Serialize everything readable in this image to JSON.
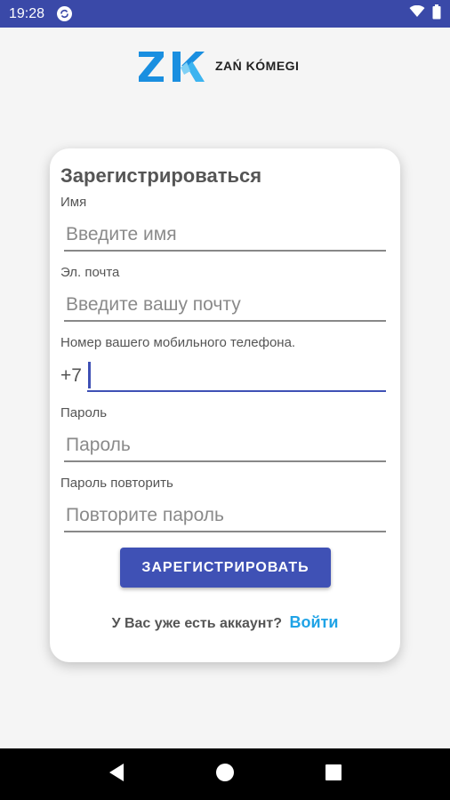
{
  "status_bar": {
    "time": "19:28",
    "icons": [
      "sync-icon",
      "wifi-icon",
      "battery-icon"
    ]
  },
  "logo": {
    "mark": "ZK",
    "text": "ZAŃ KÓMEGI",
    "colors": {
      "primary": "#1a8fe0",
      "secondary": "#3cb4f0"
    }
  },
  "form": {
    "title": "Зарегистрироваться",
    "name": {
      "label": "Имя",
      "placeholder": "Введите имя",
      "value": ""
    },
    "email": {
      "label": "Эл. почта",
      "placeholder": "Введите вашу почту",
      "value": ""
    },
    "phone": {
      "label": "Номер вашего мобильного телефона.",
      "prefix": "+7",
      "value": ""
    },
    "password": {
      "label": "Пароль",
      "placeholder": "Пароль",
      "value": ""
    },
    "password_repeat": {
      "label": "Пароль повторить",
      "placeholder": "Повторите пароль",
      "value": ""
    },
    "submit_label": "ЗАРЕГИСТРИРОВАТЬ",
    "login_prompt": "У Вас уже есть аккаунт?",
    "login_link": "Войти"
  },
  "nav_bar": {
    "buttons": [
      "back-icon",
      "home-icon",
      "recents-icon"
    ]
  },
  "colors": {
    "status_bar": "#3a49a8",
    "accent": "#3f51b5",
    "link": "#1fa3e6",
    "background": "#f5f5f5"
  }
}
